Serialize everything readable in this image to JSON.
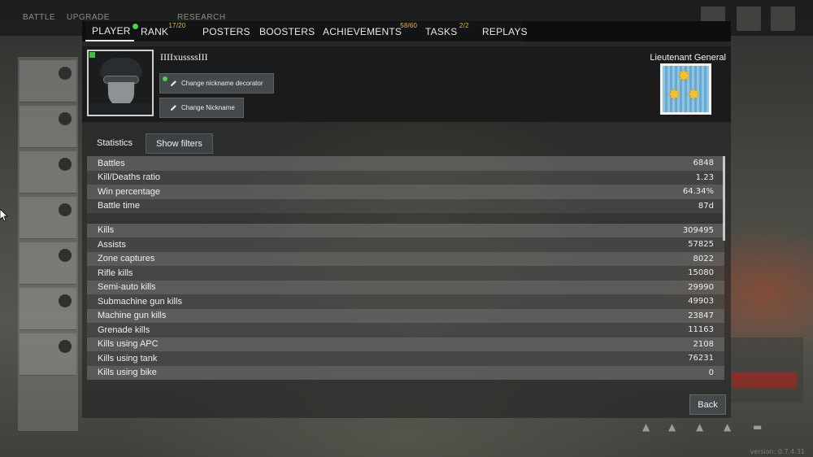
{
  "tabs": [
    {
      "label": "PLAYER",
      "sup": "",
      "dot": true,
      "active": true
    },
    {
      "label": "RANK",
      "sup": "17/20",
      "dot": false,
      "active": false
    },
    {
      "label": "POSTERS",
      "sup": "",
      "dot": false,
      "active": false
    },
    {
      "label": "BOOSTERS",
      "sup": "",
      "dot": false,
      "active": false
    },
    {
      "label": "ACHIEVEMENTS",
      "sup": "58/60",
      "dot": false,
      "active": false
    },
    {
      "label": "TASKS",
      "sup": "2/2",
      "dot": false,
      "active": false
    },
    {
      "label": "REPLAYS",
      "sup": "",
      "dot": false,
      "active": false
    }
  ],
  "profile": {
    "nickname": "IIIIxussssIII",
    "change_decorator_label": "Change nickname decorator",
    "change_nickname_label": "Change Nickname",
    "rank_title": "Lieutenant General"
  },
  "statistics": {
    "title": "Statistics",
    "show_filters_label": "Show filters",
    "groups": [
      [
        {
          "label": "Battles",
          "value": "6848"
        },
        {
          "label": "Kill/Deaths ratio",
          "value": "1.23"
        },
        {
          "label": "Win percentage",
          "value": "64.34%"
        },
        {
          "label": "Battle time",
          "value": "87d"
        }
      ],
      [
        {
          "label": "Kills",
          "value": "309495"
        },
        {
          "label": "Assists",
          "value": "57825"
        },
        {
          "label": "Zone captures",
          "value": "8022"
        },
        {
          "label": "Rifle kills",
          "value": "15080"
        },
        {
          "label": "Semi-auto kills",
          "value": "29990"
        },
        {
          "label": "Submachine gun kills",
          "value": "49903"
        },
        {
          "label": "Machine gun kills",
          "value": "23847"
        },
        {
          "label": "Grenade kills",
          "value": "11163"
        },
        {
          "label": "Kills using APC",
          "value": "2108"
        },
        {
          "label": "Kills using tank",
          "value": "76231"
        },
        {
          "label": "Kills using bike",
          "value": "0"
        }
      ]
    ]
  },
  "back_label": "Back",
  "background": {
    "topbar_items": [
      "BATTLE",
      "UPGRADE",
      "RESEARCH"
    ],
    "version": "version: 0.7.4.31"
  },
  "colors": {
    "accent_sup": "#e8b84a",
    "notify_dot": "#4bd14b",
    "insignia_blue": "#8fc4e2",
    "insignia_star": "#f2c230"
  }
}
